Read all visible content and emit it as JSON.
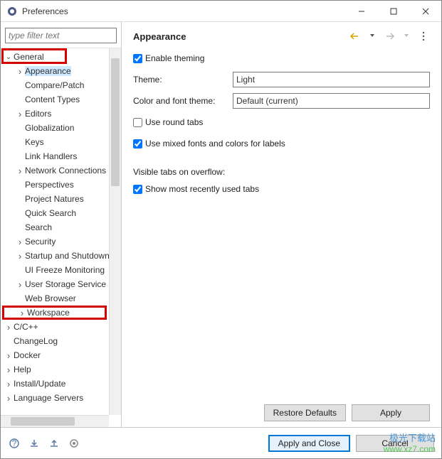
{
  "window": {
    "title": "Preferences"
  },
  "filter": {
    "placeholder": "type filter text"
  },
  "tree": [
    {
      "label": "General",
      "depth": 0,
      "expander": "v",
      "highlight": "general"
    },
    {
      "label": "Appearance",
      "depth": 1,
      "expander": ">",
      "selected": true
    },
    {
      "label": "Compare/Patch",
      "depth": 1,
      "expander": ""
    },
    {
      "label": "Content Types",
      "depth": 1,
      "expander": ""
    },
    {
      "label": "Editors",
      "depth": 1,
      "expander": ">"
    },
    {
      "label": "Globalization",
      "depth": 1,
      "expander": ""
    },
    {
      "label": "Keys",
      "depth": 1,
      "expander": ""
    },
    {
      "label": "Link Handlers",
      "depth": 1,
      "expander": ""
    },
    {
      "label": "Network Connections",
      "depth": 1,
      "expander": ">"
    },
    {
      "label": "Perspectives",
      "depth": 1,
      "expander": ""
    },
    {
      "label": "Project Natures",
      "depth": 1,
      "expander": ""
    },
    {
      "label": "Quick Search",
      "depth": 1,
      "expander": ""
    },
    {
      "label": "Search",
      "depth": 1,
      "expander": ""
    },
    {
      "label": "Security",
      "depth": 1,
      "expander": ">"
    },
    {
      "label": "Startup and Shutdown",
      "depth": 1,
      "expander": ">"
    },
    {
      "label": "UI Freeze Monitoring",
      "depth": 1,
      "expander": ""
    },
    {
      "label": "User Storage Service",
      "depth": 1,
      "expander": ">"
    },
    {
      "label": "Web Browser",
      "depth": 1,
      "expander": ""
    },
    {
      "label": "Workspace",
      "depth": 1,
      "expander": ">",
      "highlight": "workspace"
    },
    {
      "label": "C/C++",
      "depth": 0,
      "expander": ">"
    },
    {
      "label": "ChangeLog",
      "depth": 0,
      "expander": ""
    },
    {
      "label": "Docker",
      "depth": 0,
      "expander": ">"
    },
    {
      "label": "Help",
      "depth": 0,
      "expander": ">"
    },
    {
      "label": "Install/Update",
      "depth": 0,
      "expander": ">"
    },
    {
      "label": "Language Servers",
      "depth": 0,
      "expander": ">"
    }
  ],
  "panel": {
    "title": "Appearance",
    "enable_theming": "Enable theming",
    "theme_label": "Theme:",
    "theme_value": "Light",
    "colorfont_label": "Color and font theme:",
    "colorfont_value": "Default (current)",
    "round_tabs": "Use round tabs",
    "mixed_fonts": "Use mixed fonts and colors for labels",
    "visible_tabs_label": "Visible tabs on overflow:",
    "show_recent": "Show most recently used tabs"
  },
  "buttons": {
    "restore": "Restore Defaults",
    "apply": "Apply",
    "apply_close": "Apply and Close",
    "cancel": "Cancel"
  },
  "watermark": {
    "line1": "极光下载站",
    "line2": "www.xz7.com"
  }
}
